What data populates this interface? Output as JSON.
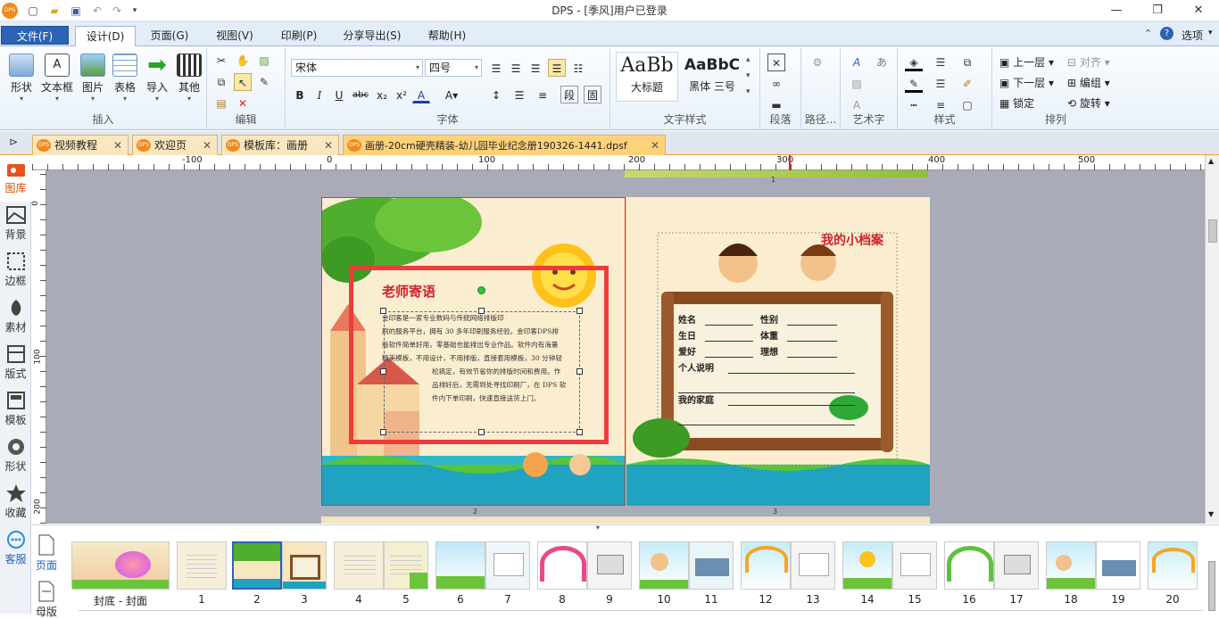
{
  "window": {
    "title": "DPS - [季风]用户已登录",
    "app_logo": "DPS"
  },
  "ribbon_tabs": [
    "文件(F)",
    "设计(D)",
    "页面(G)",
    "视图(V)",
    "印刷(P)",
    "分享导出(S)",
    "帮助(H)"
  ],
  "ribbon_right": {
    "options_label": "选项"
  },
  "insert_group": {
    "label": "插入",
    "buttons": [
      "形状",
      "文本框",
      "图片",
      "表格",
      "导入",
      "其他"
    ]
  },
  "edit_group": {
    "label": "编辑"
  },
  "font_group": {
    "label": "字体",
    "font_name": "宋体",
    "font_size": "四号"
  },
  "text_style_group": {
    "label": "文字样式",
    "style1_sample": "AaBb",
    "style1_name": "大标题",
    "style2_sample": "AaBbC",
    "style2_name": "黑体 三号"
  },
  "para_group": {
    "label": "段落"
  },
  "path_group": {
    "label": "路径..."
  },
  "art_group": {
    "label": "艺术字"
  },
  "style_group": {
    "label": "样式"
  },
  "arrange_group": {
    "label": "排列",
    "items": [
      "上一层",
      "对齐",
      "下一层",
      "编组",
      "锁定",
      "旋转"
    ]
  },
  "doc_tabs": [
    "视频教程",
    "欢迎页",
    "模板库：画册",
    "画册-20cm硬壳精装-幼儿园毕业纪念册190326-1441.dpsf"
  ],
  "left_bar": [
    "图库",
    "背景",
    "边框",
    "素材",
    "版式",
    "模板",
    "形状",
    "收藏",
    "客服"
  ],
  "ruler": {
    "h_labels": [
      "-100",
      "0",
      "100",
      "200",
      "300",
      "400",
      "500"
    ],
    "v_labels": [
      "0",
      "100",
      "200"
    ]
  },
  "left_page": {
    "title": "老师寄语",
    "body_line1": "金印客是一家专业数码与传统网络排版印",
    "body_line2": "刷的服务平台，拥有 30 多年印刷服务经验。金印客DPS排",
    "body_line3": "版软件简单好用，零基础也能排出专业作品。软件内有海量",
    "body_line4": "精美模板，不用设计，不用排版，直接套用模板，30 分钟轻",
    "body_line5": "松搞定，有效节省你的排版时间和费用。作",
    "body_line6": "品排好后，无需到处寻找印刷厂，在 DPS 软",
    "body_line7": "件内下单印刷，快速直接送货上门。",
    "page_no": "2"
  },
  "right_page": {
    "title": "我的小档案",
    "name": "姓名",
    "gender": "性别",
    "birthday": "生日",
    "weight": "体重",
    "hobby": "爱好",
    "dream": "理想",
    "intro": "个人说明",
    "family": "我的家庭",
    "page_no": "3"
  },
  "top_page_no": "1",
  "thumb_sidebar": [
    "页面",
    "母版"
  ],
  "thumbnails": [
    "封底 - 封面",
    "1",
    "2",
    "3",
    "4",
    "5",
    "6",
    "7",
    "8",
    "9",
    "10",
    "11",
    "12",
    "13",
    "14",
    "15",
    "16",
    "17",
    "18",
    "19",
    "20"
  ],
  "colors": {
    "accent": "#2b63b4",
    "tab_orange": "#f0a030",
    "selection_red": "#ef3b3b",
    "title_red": "#d0202a"
  }
}
